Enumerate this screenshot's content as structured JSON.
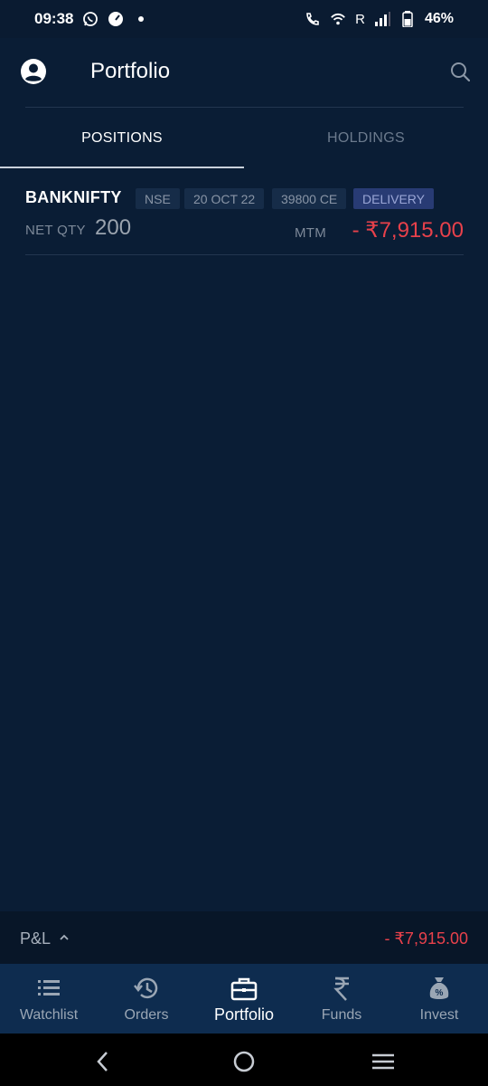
{
  "status_bar": {
    "time": "09:38",
    "network_indicator": "R",
    "battery": "46%"
  },
  "header": {
    "title": "Portfolio",
    "icons": [
      "account-circle-icon",
      "search-icon"
    ]
  },
  "tabs": [
    {
      "label": "POSITIONS",
      "active": true
    },
    {
      "label": "HOLDINGS",
      "active": false
    }
  ],
  "positions": [
    {
      "symbol": "BANKNIFTY",
      "exchange": "NSE",
      "expiry": "20 OCT 22",
      "strike": "39800 CE",
      "product": "DELIVERY",
      "net_qty_label": "NET QTY",
      "net_qty": "200",
      "mtm_label": "MTM",
      "mtm": "- ₹7,915.00"
    }
  ],
  "pnl": {
    "label": "P&L",
    "value": "- ₹7,915.00"
  },
  "bottom_nav": [
    {
      "label": "Watchlist",
      "icon": "list-icon",
      "active": false
    },
    {
      "label": "Orders",
      "icon": "history-icon",
      "active": false
    },
    {
      "label": "Portfolio",
      "icon": "briefcase-icon",
      "active": true
    },
    {
      "label": "Funds",
      "icon": "rupee-icon",
      "active": false
    },
    {
      "label": "Invest",
      "icon": "money-bag-icon",
      "active": false
    }
  ],
  "colors": {
    "background": "#0a1d35",
    "loss": "#e8414b",
    "nav_background": "#0e2c4f",
    "delivery_chip": "#283b74"
  }
}
